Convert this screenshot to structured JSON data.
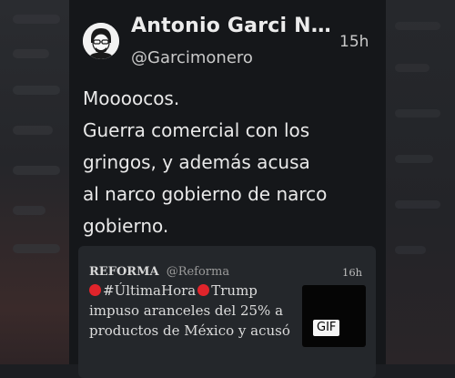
{
  "tweet": {
    "author_name": "Antonio Garci N…",
    "handle": "@Garcimonero",
    "time": "15h",
    "avatar_icon": "cartoon-avatar-icon",
    "body_lines": [
      "Moooocos.",
      "Guerra comercial con los",
      "gringos, y además acusa",
      "al narco gobierno de narco",
      "gobierno."
    ]
  },
  "quoted_tweet": {
    "author_name": "REFORMA",
    "handle": "@Reforma",
    "time": "16h",
    "text_line1_a": "#ÚltimaHora",
    "text_line1_b": "Trump",
    "text_line2": "impuso aranceles del 25% a",
    "text_line3": "productos de México y acusó",
    "media_badge": "GIF"
  },
  "colors": {
    "card_background": "#15171a",
    "quote_background": "#24272b",
    "text_primary": "#e9e9e9",
    "text_secondary": "#c9c9c9",
    "alert_dot": "#e0242b"
  }
}
